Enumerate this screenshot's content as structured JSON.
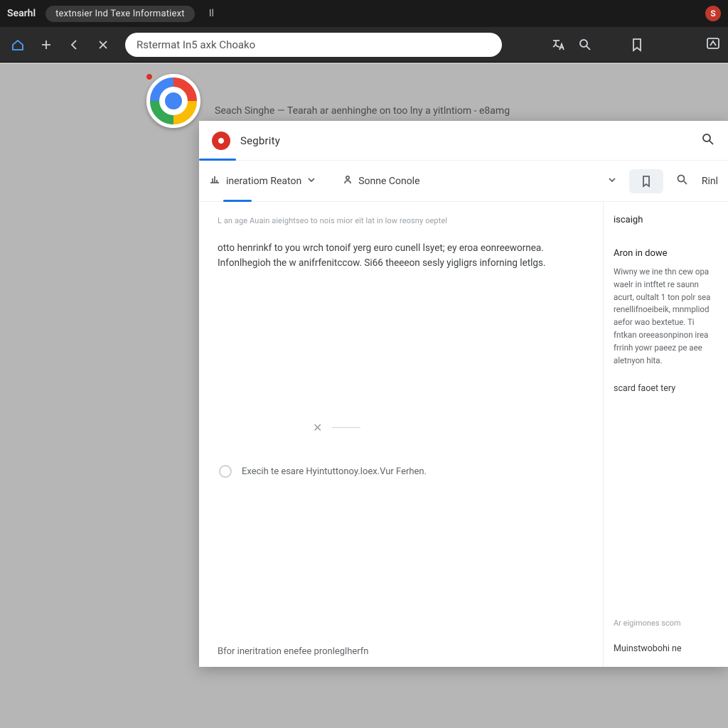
{
  "menu": {
    "app_name": "Searhl",
    "pill": "textnsier Ind Texe Informatiext",
    "tail": "Il",
    "profile_initial": "S"
  },
  "browser": {
    "url_text": "Rstermat In5 axk Choako"
  },
  "page_header": {
    "tagline": "Seach Singhe — Tearah ar aenhinghe on too lny a yitlntiom - e8amg"
  },
  "panel": {
    "title": "Segbrity",
    "tabs": {
      "primary": "ineratiom Reaton",
      "secondary": "Sonne Conole",
      "right_label": "Rinl"
    },
    "main": {
      "hint": "L an age Auain aieightseo to nois mior eït lat in low reosny oeptel",
      "paragraph": "otto henrinkf to you wrch tonoif yerg euro cunell lsyet; ey eroa eonreewornea. Infonlhegioh the w anifrfenitccow. Si66 theeeon sesly yigligrs inforning letlgs.",
      "divider_x": "✕",
      "radio_label": "Execih te esare Hyintuttonoy.loex.Vur Ferhen.",
      "footer": "Bfor ineritration enefee pronleglherfn"
    },
    "side": {
      "heading": "iscaigh",
      "sub": "Aron in dowe",
      "paragraph": "Wiwny we ine thn cew opa waelr in intftet re saunn acurt, oultalt 1 ton polr sea renellifnoeibeik, mnmpliod aefor wao bextetue. Ti fntkan oreeasonpinon irea frrinh yowr paeez pe aee aletnyon hita.",
      "link1": "scard faoet tery",
      "small": "Ar eigimones scom",
      "link2": "Muinstwobohi ne"
    }
  }
}
